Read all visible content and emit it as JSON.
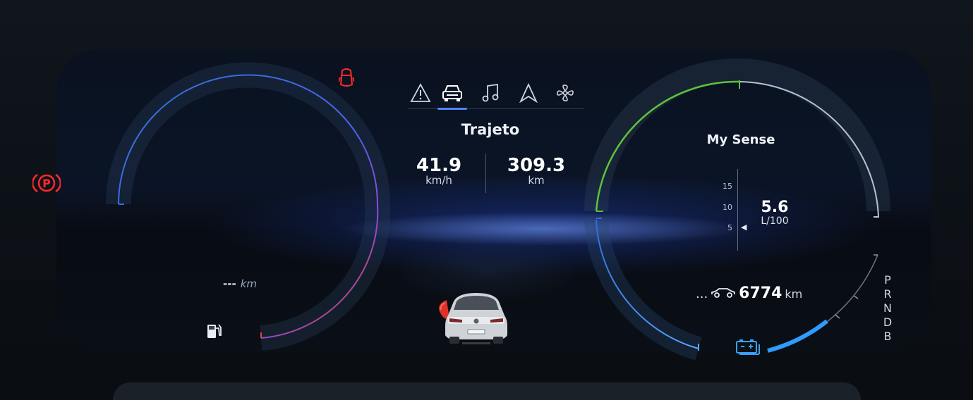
{
  "center": {
    "tabs": [
      {
        "name": "warning-tab",
        "icon": "warning-triangle-icon",
        "active": false
      },
      {
        "name": "vehicle-tab",
        "icon": "car-front-icon",
        "active": true
      },
      {
        "name": "music-tab",
        "icon": "music-note-icon",
        "active": false
      },
      {
        "name": "navigation-tab",
        "icon": "navigation-arrow-icon",
        "active": false
      },
      {
        "name": "climate-tab",
        "icon": "fan-icon",
        "active": false
      }
    ],
    "title": "Trajeto",
    "avg_speed": {
      "value": "41.9",
      "unit": "km/h"
    },
    "distance": {
      "value": "309.3",
      "unit": "km"
    }
  },
  "left_gauge": {
    "fuel_range_value": "---",
    "fuel_range_unit": "km",
    "fuel_icon": "fuel-pump-icon",
    "door_open_icon": "door-open-warning-icon",
    "parking_brake_icon": "parking-brake-icon",
    "colors": {
      "arc_blue": "#3a7ae0",
      "arc_purple": "#6b4de6",
      "arc_red": "#e0453a"
    }
  },
  "right_gauge": {
    "mode_label": "My Sense",
    "scale_ticks": [
      "15",
      "10",
      "5"
    ],
    "consumption_value": "5.6",
    "consumption_unit": "L/100",
    "range_prefix": "...",
    "range_icon": "car-side-icon",
    "range_value": "6774",
    "range_unit": "km",
    "battery_icon": "battery-icon",
    "colors": {
      "eco_green": "#5fc23a",
      "arc_gray": "#b8c2cf",
      "arc_blue": "#3a8ae8"
    }
  },
  "gear_selector": [
    "P",
    "R",
    "N",
    "D",
    "B"
  ],
  "status_colors": {
    "warning_red": "#ff2a2a",
    "accent_blue": "#4a7dff",
    "battery_blue": "#3aa0ff"
  }
}
